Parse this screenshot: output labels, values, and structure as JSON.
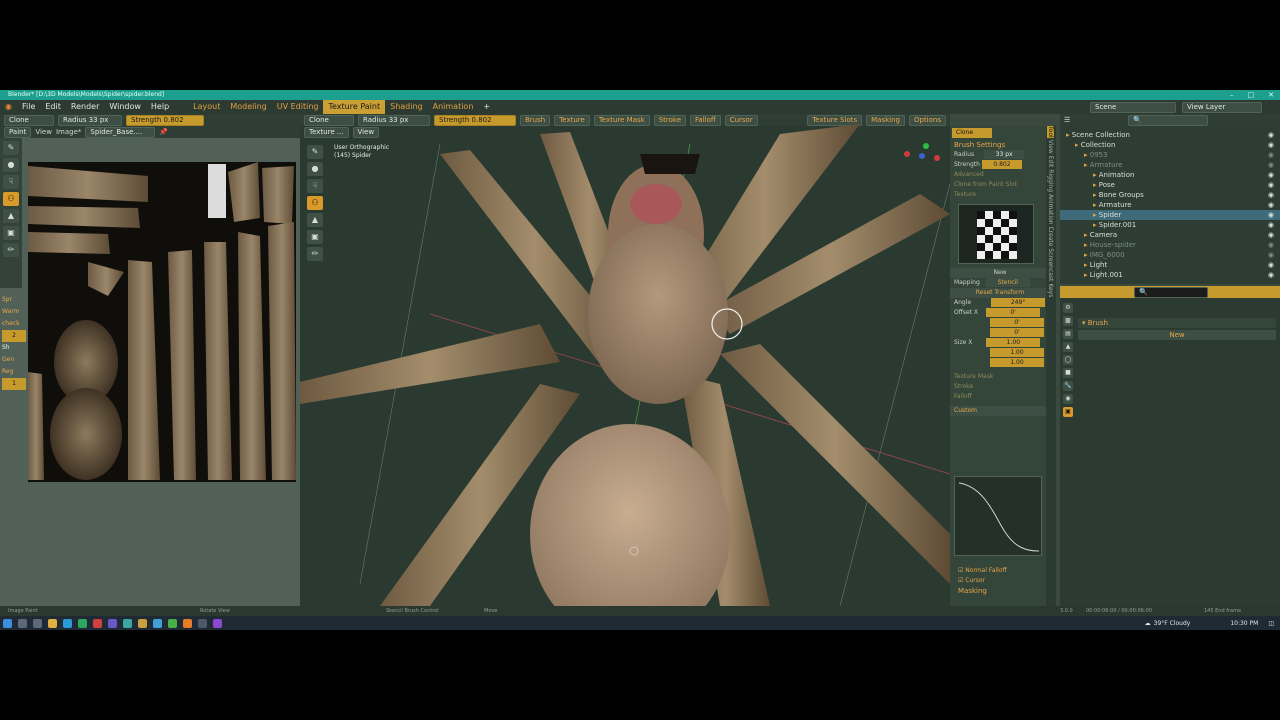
{
  "window": {
    "title": "Blender* [D:\\3D Models\\Models\\Spider\\spider.blend]"
  },
  "menu": {
    "items": [
      "File",
      "Edit",
      "Render",
      "Window",
      "Help"
    ]
  },
  "workspaces": [
    "Layout",
    "Modeling",
    "UV Editing",
    "Texture Paint",
    "Shading",
    "Animation"
  ],
  "active_workspace": "Texture Paint",
  "image_header": {
    "tool": "Clone",
    "radius_label": "Radius",
    "radius_value": "33 px",
    "strength_label": "Strength",
    "strength_value": "0.802",
    "mode": "Paint",
    "view": "View",
    "image_menu": "Image*",
    "image_name": "Spider_Base...."
  },
  "image_sidebar": {
    "labels": [
      "Spr",
      "Warm",
      "check",
      "2",
      "Sh",
      "Gen",
      "Reg",
      "1"
    ]
  },
  "viewport_header": {
    "tool": "Clone",
    "radius_label": "Radius",
    "radius_value": "33 px",
    "strength_label": "Strength",
    "strength_value": "0.802",
    "menus": [
      "Brush",
      "Texture",
      "Texture Mask",
      "Stroke",
      "Falloff",
      "Cursor"
    ],
    "right_menus": [
      "Texture Slots",
      "Masking",
      "Options"
    ],
    "mode": "Texture ...",
    "view": "View"
  },
  "viewport": {
    "overlay_line1": "User Orthographic",
    "overlay_line2": "(145) Spider"
  },
  "tool_panel": {
    "brush_name": "Clone",
    "brush_settings": "Brush Settings",
    "radius_label": "Radius",
    "radius_value": "33 px",
    "strength_label": "Strength",
    "strength_value": "0.802",
    "advanced": "Advanced",
    "clone_from": "Clone from Paint Slot",
    "texture": "Texture",
    "new_button": "New",
    "mapping_label": "Mapping",
    "mapping_value": "Stencil",
    "reset_transform": "Reset Transform",
    "angle_label": "Angle",
    "angle_value": "249°",
    "offset_label": "Offset X",
    "offset_values": [
      "0'",
      "0'",
      "0'"
    ],
    "size_label": "Size X",
    "size_values": [
      "1.00",
      "1.00",
      "1.00"
    ],
    "subsections": [
      "Texture Mask",
      "Stroke",
      "Falloff"
    ],
    "custom": "Custom",
    "normal_falloff": "Normal Falloff",
    "cursor": "Cursor",
    "masking": "Masking"
  },
  "vertical_tabs": [
    "Tool",
    "View",
    "Edit",
    "Rigging",
    "Animation",
    "Create",
    "Screencast Keys"
  ],
  "outliner": {
    "scene_label": "Scene",
    "view_layer": "View Layer",
    "rows": [
      {
        "text": "Scene Collection",
        "indent": 0,
        "state": "normal"
      },
      {
        "text": "Collection",
        "indent": 1,
        "state": "normal"
      },
      {
        "text": "0953",
        "indent": 2,
        "state": "dim"
      },
      {
        "text": "Armature",
        "indent": 2,
        "state": "dim"
      },
      {
        "text": "Animation",
        "indent": 3,
        "state": "normal"
      },
      {
        "text": "Pose",
        "indent": 3,
        "state": "normal"
      },
      {
        "text": "Bone Groups",
        "indent": 3,
        "state": "normal"
      },
      {
        "text": "Armature",
        "indent": 3,
        "state": "normal"
      },
      {
        "text": "Spider",
        "indent": 3,
        "state": "sel"
      },
      {
        "text": "Spider.001",
        "indent": 3,
        "state": "normal"
      },
      {
        "text": "Camera",
        "indent": 2,
        "state": "normal"
      },
      {
        "text": "House-spider",
        "indent": 2,
        "state": "dim"
      },
      {
        "text": "IMG_6000",
        "indent": 2,
        "state": "dim"
      },
      {
        "text": "Light",
        "indent": 2,
        "state": "normal"
      },
      {
        "text": "Light.001",
        "indent": 2,
        "state": "normal"
      }
    ]
  },
  "properties": {
    "brush_label": "Brush",
    "new_button": "New"
  },
  "statusbar": {
    "left": "Image Paint",
    "mid1": "Rotate View",
    "mid2": "Stencil Brush Control",
    "mid3": "Move",
    "right1": "3.0.0",
    "right2": "00:00:06:00 / 00:00:06:00",
    "right3": "145 End frame"
  },
  "taskbar": {
    "weather": "39°F Cloudy",
    "time": "10:30 PM"
  },
  "colors": {
    "accent": "#c79a2e",
    "titlebar": "#1d9f8f",
    "panel": "#3a4a3f"
  }
}
